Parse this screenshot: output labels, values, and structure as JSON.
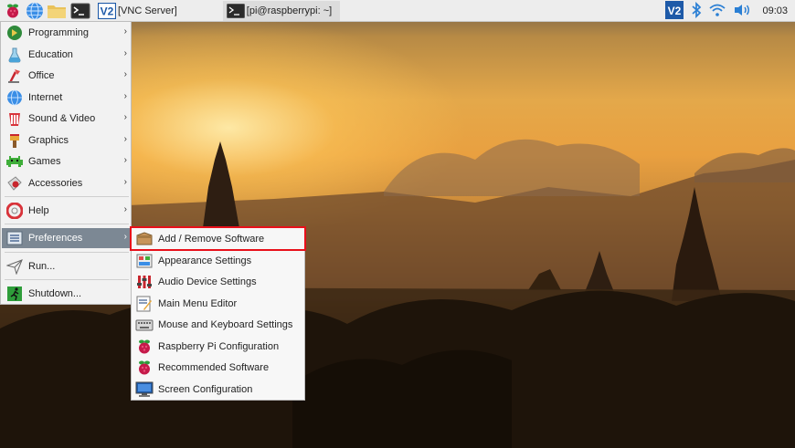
{
  "taskbar": {
    "tasks": [
      {
        "label": "[VNC Server]"
      },
      {
        "label": "[pi@raspberrypi: ~]"
      }
    ],
    "clock": "09:03"
  },
  "main_menu": {
    "items": [
      {
        "label": "Programming",
        "icon": "programming-icon"
      },
      {
        "label": "Education",
        "icon": "education-icon"
      },
      {
        "label": "Office",
        "icon": "office-icon"
      },
      {
        "label": "Internet",
        "icon": "globe-icon"
      },
      {
        "label": "Sound & Video",
        "icon": "sound-video-icon"
      },
      {
        "label": "Graphics",
        "icon": "graphics-icon"
      },
      {
        "label": "Games",
        "icon": "games-icon"
      },
      {
        "label": "Accessories",
        "icon": "accessories-icon"
      },
      {
        "label": "Help",
        "icon": "help-icon"
      },
      {
        "label": "Preferences",
        "icon": "preferences-icon"
      },
      {
        "label": "Run...",
        "icon": "run-icon"
      },
      {
        "label": "Shutdown...",
        "icon": "shutdown-icon"
      }
    ]
  },
  "preferences_menu": {
    "items": [
      {
        "label": "Add / Remove Software",
        "icon": "package-icon"
      },
      {
        "label": "Appearance Settings",
        "icon": "appearance-icon"
      },
      {
        "label": "Audio Device Settings",
        "icon": "audio-icon"
      },
      {
        "label": "Main Menu Editor",
        "icon": "menu-editor-icon"
      },
      {
        "label": "Mouse and Keyboard Settings",
        "icon": "keyboard-icon"
      },
      {
        "label": "Raspberry Pi Configuration",
        "icon": "raspberry-icon"
      },
      {
        "label": "Recommended Software",
        "icon": "raspberry-icon"
      },
      {
        "label": "Screen Configuration",
        "icon": "monitor-icon"
      }
    ]
  },
  "colors": {
    "menu_highlight": "#7c8894",
    "annotation_box": "#e8101a",
    "vnc_blue": "#1e5aa8"
  }
}
